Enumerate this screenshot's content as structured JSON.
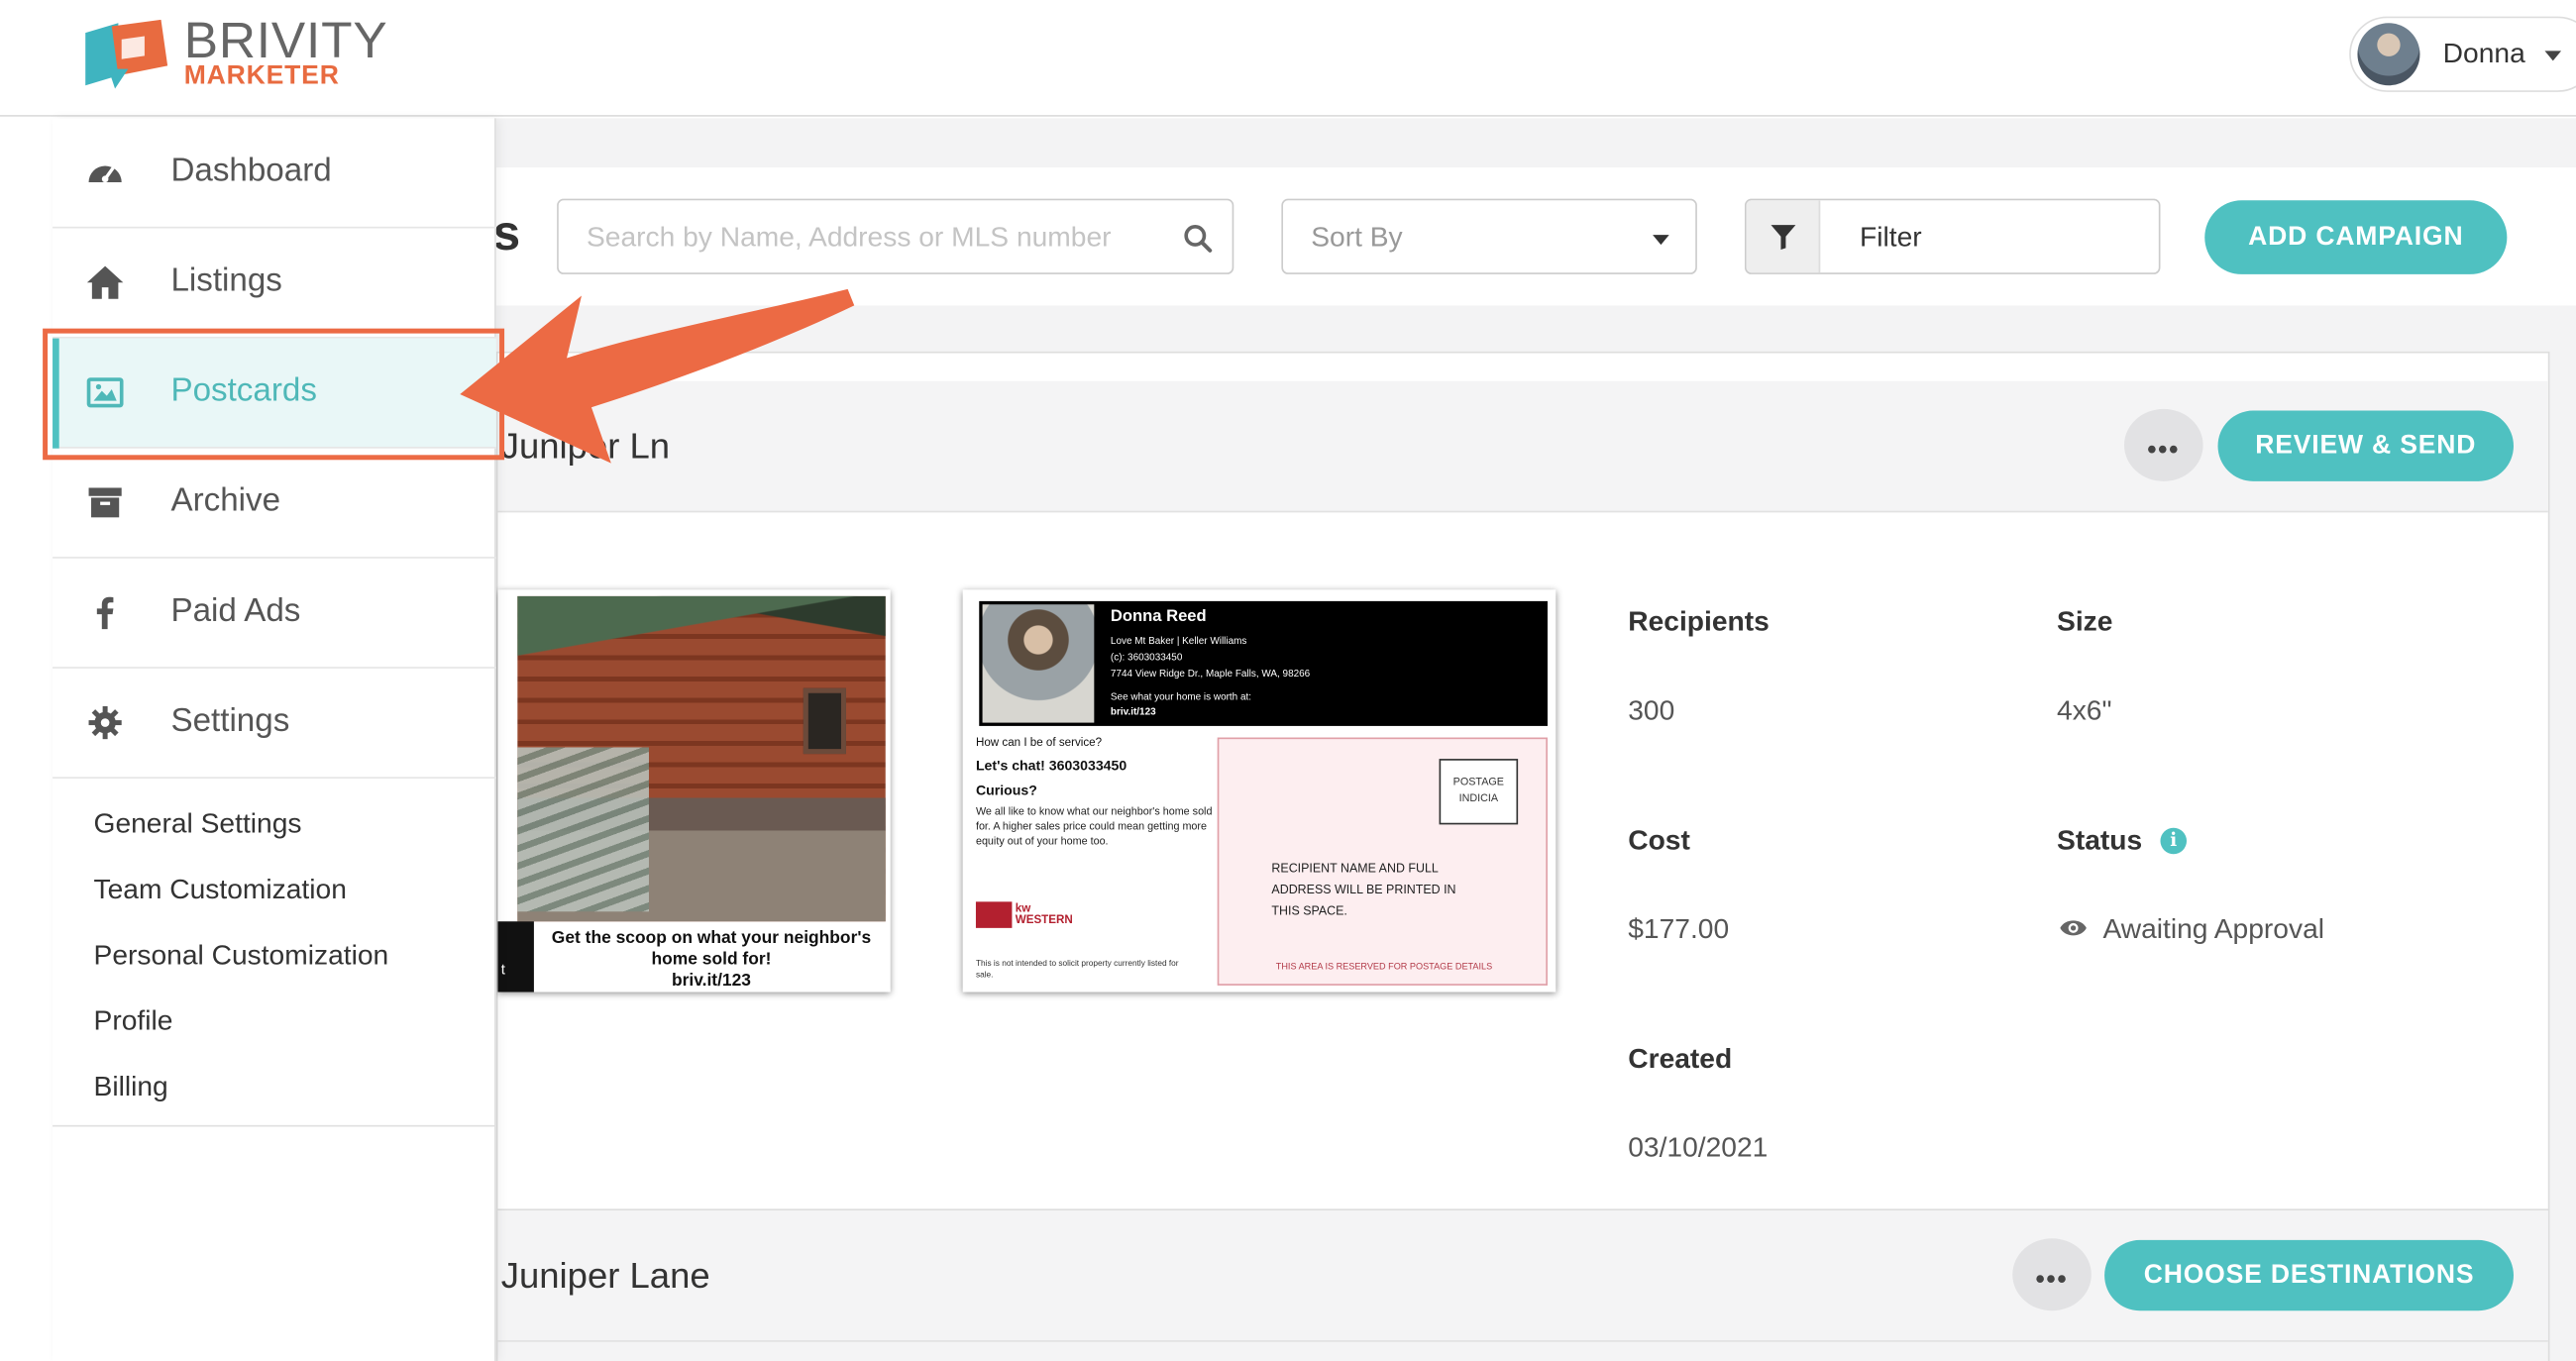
{
  "brand": {
    "name_top": "BRIVITY",
    "name_bottom": "MARKETER",
    "accent": "#e86b40",
    "teal": "#4fc1c1"
  },
  "user": {
    "name": "Donna"
  },
  "sidebar": {
    "items": [
      {
        "label": "Dashboard",
        "icon": "dashboard-gauge-icon"
      },
      {
        "label": "Listings",
        "icon": "home-icon"
      },
      {
        "label": "Postcards",
        "icon": "image-icon",
        "active": true
      },
      {
        "label": "Archive",
        "icon": "archive-box-icon"
      },
      {
        "label": "Paid Ads",
        "icon": "facebook-icon"
      },
      {
        "label": "Settings",
        "icon": "gear-icon"
      }
    ],
    "settings_links": [
      "General Settings",
      "Team Customization",
      "Personal Customization",
      "Profile",
      "Billing"
    ]
  },
  "toolbar": {
    "title_fragment": "s",
    "search_placeholder": "Search by Name, Address or MLS number",
    "sort_placeholder": "Sort By",
    "filter_label": "Filter",
    "add_button": "ADD CAMPAIGN"
  },
  "campaigns": [
    {
      "title": "Juniper Ln",
      "primary_action": "REVIEW & SEND",
      "more_label": "•••",
      "front": {
        "caption": "Get the scoop on what your neighbor's home sold for!",
        "caption_link": "briv.it/123",
        "edge_char": "t"
      },
      "back": {
        "agent_name": "Donna Reed",
        "line1": "Love Mt Baker | Keller Williams",
        "line2": "(c): 3603033450",
        "line3": "7744 View Ridge Dr., Maple Falls, WA, 98266",
        "line4": "See what your home is worth at:",
        "line5": "briv.it/123",
        "q1": "How can I be of service?",
        "q2": "Let's chat! 3603033450",
        "q3": "Curious?",
        "body": "We all like to know what our neighbor's home sold for. A higher sales price could mean getting more equity out of your home too.",
        "logo_text": "kw WESTERN",
        "disclaimer": "This is not intended to solicit property currently listed for sale.",
        "postage": "POSTAGE INDICIA",
        "recipient": "RECIPIENT NAME AND FULL ADDRESS WILL BE PRINTED IN THIS SPACE.",
        "reserved": "THIS AREA IS RESERVED FOR POSTAGE DETAILS"
      },
      "details": {
        "recipients_label": "Recipients",
        "recipients": "300",
        "size_label": "Size",
        "size": "4x6\"",
        "cost_label": "Cost",
        "cost": "$177.00",
        "status_label": "Status",
        "status": "Awaiting Approval",
        "created_label": "Created",
        "created": "03/10/2021"
      }
    },
    {
      "title": "Juniper Lane",
      "primary_action": "CHOOSE DESTINATIONS",
      "more_label": "•••"
    }
  ]
}
